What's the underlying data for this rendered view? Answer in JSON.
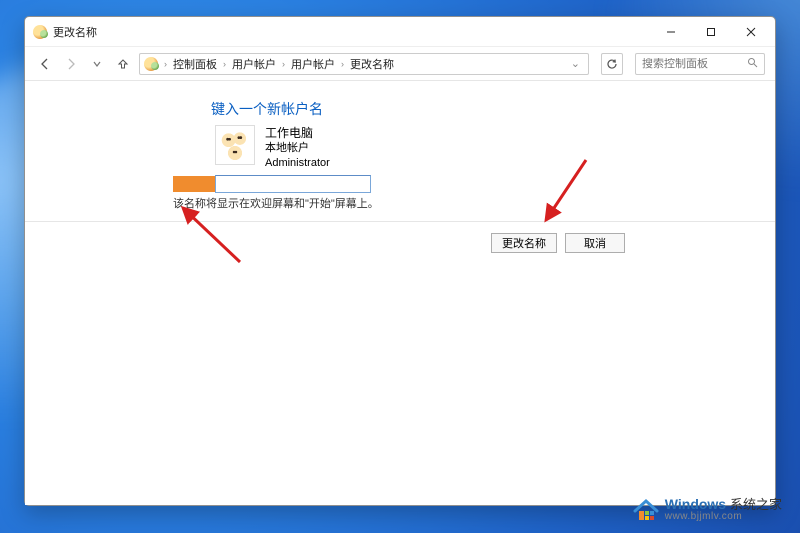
{
  "window": {
    "title": "更改名称"
  },
  "nav": {
    "breadcrumbs": [
      "控制面板",
      "用户帐户",
      "用户帐户",
      "更改名称"
    ],
    "search_placeholder": "搜索控制面板"
  },
  "page": {
    "heading": "键入一个新帐户名",
    "account": {
      "display_name": "工作电脑",
      "account_type": "本地帐户",
      "role": "Administrator"
    },
    "name_input_value": "",
    "helper_text": "该名称将显示在欢迎屏幕和\"开始\"屏幕上。",
    "buttons": {
      "submit": "更改名称",
      "cancel": "取消"
    }
  },
  "watermark": {
    "brand": "Windows",
    "brand_cn": "系统之家",
    "url": "www.bjjmlv.com"
  },
  "colors": {
    "link": "#0a5fc2",
    "arrow": "#d62020",
    "redact": "#f08c2e"
  }
}
